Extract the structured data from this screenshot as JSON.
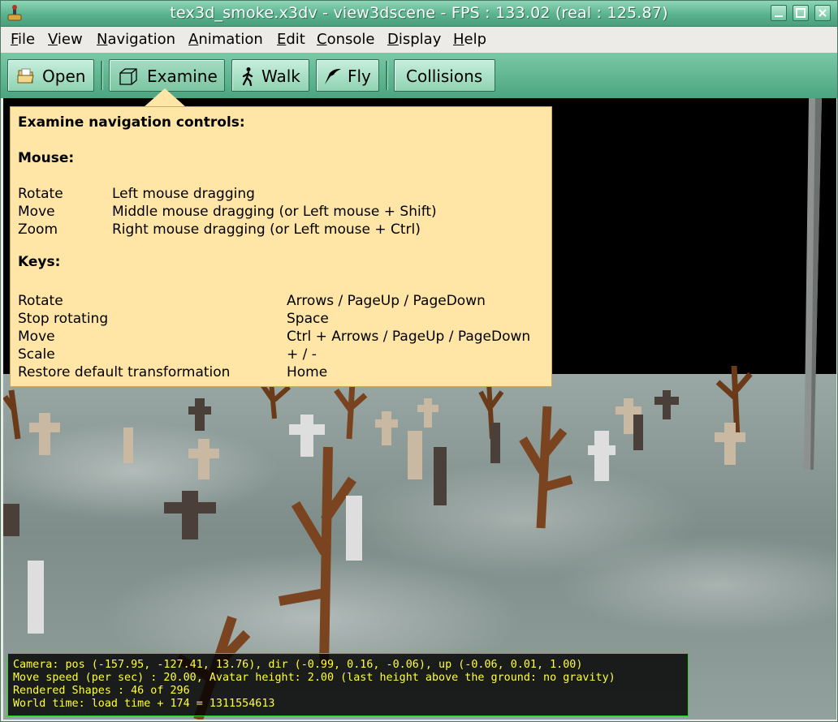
{
  "window": {
    "title": "tex3d_smoke.x3dv - view3dscene - FPS : 133.02 (real : 125.87)",
    "icons": {
      "app": "joystick-icon",
      "minimize": "minimize-icon",
      "maximize": "maximize-icon",
      "close": "close-icon"
    }
  },
  "menu": {
    "items": [
      {
        "first": "F",
        "rest": "ile"
      },
      {
        "first": "V",
        "rest": "iew"
      },
      {
        "first": "N",
        "rest": "avigation"
      },
      {
        "first": "A",
        "rest": "nimation"
      },
      {
        "first": "E",
        "rest": "dit"
      },
      {
        "first": "C",
        "rest": "onsole"
      },
      {
        "first": "D",
        "rest": "isplay"
      },
      {
        "first": "H",
        "rest": "elp"
      }
    ]
  },
  "toolbar": {
    "open": "Open",
    "examine": "Examine",
    "walk": "Walk",
    "fly": "Fly",
    "collisions": "Collisions",
    "active_mode": "Examine",
    "icons": {
      "open": "folder-open-icon",
      "examine": "cube-icon",
      "walk": "walking-person-icon",
      "fly": "fly-icon"
    }
  },
  "help": {
    "title": "Examine navigation controls:",
    "mouse_heading": "Mouse:",
    "mouse": [
      {
        "action": "Rotate",
        "control": "Left mouse dragging"
      },
      {
        "action": "Move",
        "control": "Middle mouse dragging (or Left mouse + Shift)"
      },
      {
        "action": "Zoom",
        "control": "Right mouse dragging (or Left mouse + Ctrl)"
      }
    ],
    "keys_heading": "Keys:",
    "keys": [
      {
        "action": "Rotate",
        "control": "Arrows / PageUp / PageDown"
      },
      {
        "action": "Stop rotating",
        "control": "Space"
      },
      {
        "action": "Move",
        "control": "Ctrl + Arrows / PageUp / PageDown"
      },
      {
        "action": "Scale",
        "control": "+ / -"
      },
      {
        "action": "Restore default transformation",
        "control": "Home"
      }
    ]
  },
  "status": {
    "lines": [
      "Camera: pos (-157.95, -127.41, 13.76), dir (-0.99, 0.16, -0.06), up (-0.06, 0.01, 1.00)",
      "Move speed (per sec) : 20.00, Avatar height: 2.00 (last height above the ground: no gravity)",
      "Rendered Shapes : 46 of 296",
      "World time: load time + 174 = 1311554613"
    ],
    "text_color": "#ffff38",
    "border_color": "#2fd02f"
  },
  "colors": {
    "titlebar": "#5ab28e",
    "toolbar": "#4ba57f",
    "tooltip_bg": "#ffe6a6",
    "sky": "#000000"
  }
}
